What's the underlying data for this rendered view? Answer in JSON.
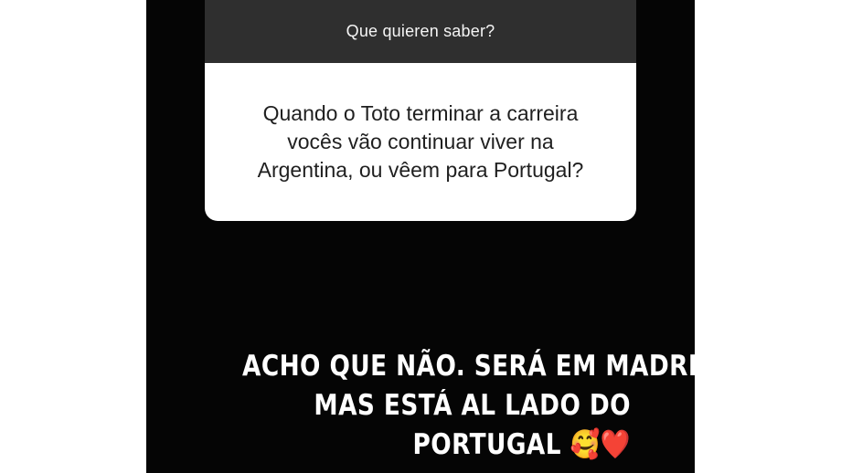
{
  "story": {
    "question_sticker": {
      "title": "Que quieren saber?",
      "question_lines": [
        "Quando o Toto terminar a carreira",
        "vocês vão continuar viver na",
        "Argentina, ou vêem para Portugal?"
      ]
    },
    "answer": {
      "lines": [
        "ACHO QUE NÃO. SERÁ EM MADRID",
        "MAS ESTÁ AL LADO DO",
        "PORTUGAL"
      ],
      "emojis": "🥰❤️"
    }
  }
}
